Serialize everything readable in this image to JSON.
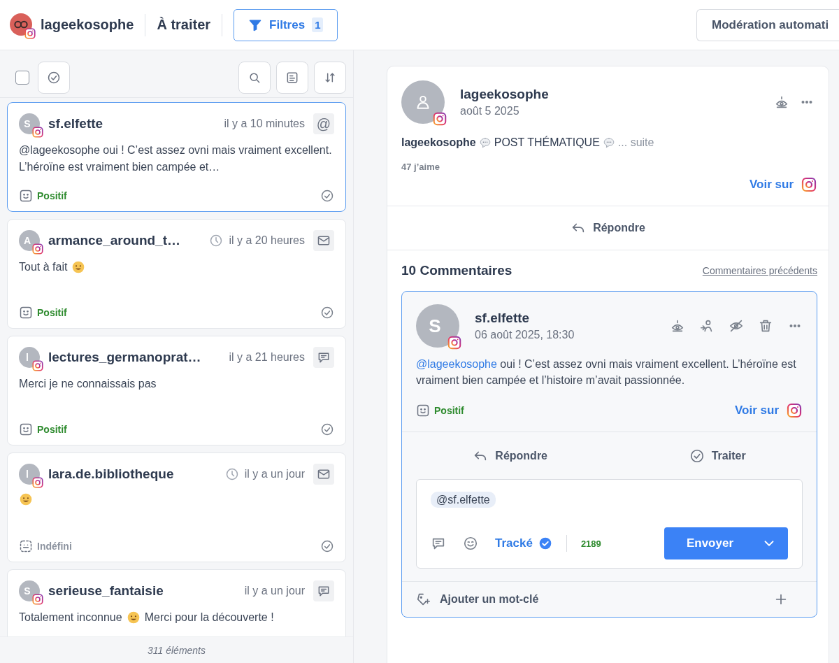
{
  "header": {
    "account": "lageekosophe",
    "view": "À traiter",
    "filter": {
      "label": "Filtres",
      "count": "1"
    },
    "automod": "Modération automati"
  },
  "list_toolbar": {
    "select_all": {
      "checked": false
    }
  },
  "messages": [
    {
      "author": "sf.elfette",
      "initial": "S",
      "time": "il y a 10 minutes",
      "clock": false,
      "type": {
        "kind": "mention",
        "symbol": "@"
      },
      "body": [
        {
          "kind": "text",
          "text": "@lageekosophe oui ! C’est assez ovni mais vraiment excellent. L’héroïne est vraiment bien campée et…"
        }
      ],
      "sentiment": {
        "kind": "positive",
        "label": "Positif"
      },
      "selected": true
    },
    {
      "author": "armance_around_t…",
      "initial": "A",
      "time": "il y a 20 heures",
      "clock": true,
      "type": {
        "kind": "mail"
      },
      "body": [
        {
          "kind": "text",
          "text": "Tout à fait"
        },
        {
          "kind": "emoji"
        }
      ],
      "sentiment": {
        "kind": "positive",
        "label": "Positif"
      },
      "selected": false
    },
    {
      "author": "lectures_germanoprat…",
      "initial": "l",
      "time": "il y a 21 heures",
      "clock": false,
      "type": {
        "kind": "comment"
      },
      "body": [
        {
          "kind": "text",
          "text": "Merci je ne connaissais pas"
        }
      ],
      "sentiment": {
        "kind": "positive",
        "label": "Positif"
      },
      "selected": false
    },
    {
      "author": "lara.de.bibliotheque",
      "initial": "l",
      "time": "il y a un jour",
      "clock": true,
      "type": {
        "kind": "mail"
      },
      "body": [
        {
          "kind": "emoji"
        }
      ],
      "sentiment": {
        "kind": "undefined",
        "label": "Indéfini"
      },
      "selected": false
    },
    {
      "author": "serieuse_fantaisie",
      "initial": "S",
      "time": "il y a un jour",
      "clock": false,
      "type": {
        "kind": "comment"
      },
      "body": [
        {
          "kind": "text",
          "text": "Totalement inconnue"
        },
        {
          "kind": "emoji"
        },
        {
          "kind": "text",
          "text": "Merci pour la découverte !"
        }
      ],
      "selected": false
    }
  ],
  "list_footer": "311 éléments",
  "post": {
    "author": "lageekosophe",
    "date": "août 5 2025",
    "caption": [
      {
        "kind": "bold",
        "text": "lageekosophe"
      },
      {
        "kind": "bubble"
      },
      {
        "kind": "text",
        "text": "POST THÉMATIQUE"
      },
      {
        "kind": "bubble"
      },
      {
        "kind": "more",
        "text": "... suite"
      }
    ],
    "likes": "47 j’aime",
    "view_on": "Voir sur",
    "reply": "Répondre"
  },
  "comments": {
    "title": "10 Commentaires",
    "previous": "Commentaires précédents",
    "comment": {
      "author": "sf.elfette",
      "initial": "S",
      "date": "06 août 2025, 18:30",
      "mention": "@lageekosophe",
      "text": " oui ! C’est assez ovni mais vraiment excellent. L’héroïne est vraiment bien campée et l’histoire m’avait passionnée.",
      "sentiment": {
        "kind": "positive",
        "label": "Positif"
      },
      "view_on": "Voir sur",
      "reply": "Répondre",
      "process": "Traiter",
      "composer": {
        "tag": "@sf.elfette",
        "tracked": {
          "label": "Tracké",
          "checked": true
        },
        "count": "2189",
        "send": "Envoyer"
      },
      "keyword": "Ajouter un mot-clé"
    }
  }
}
